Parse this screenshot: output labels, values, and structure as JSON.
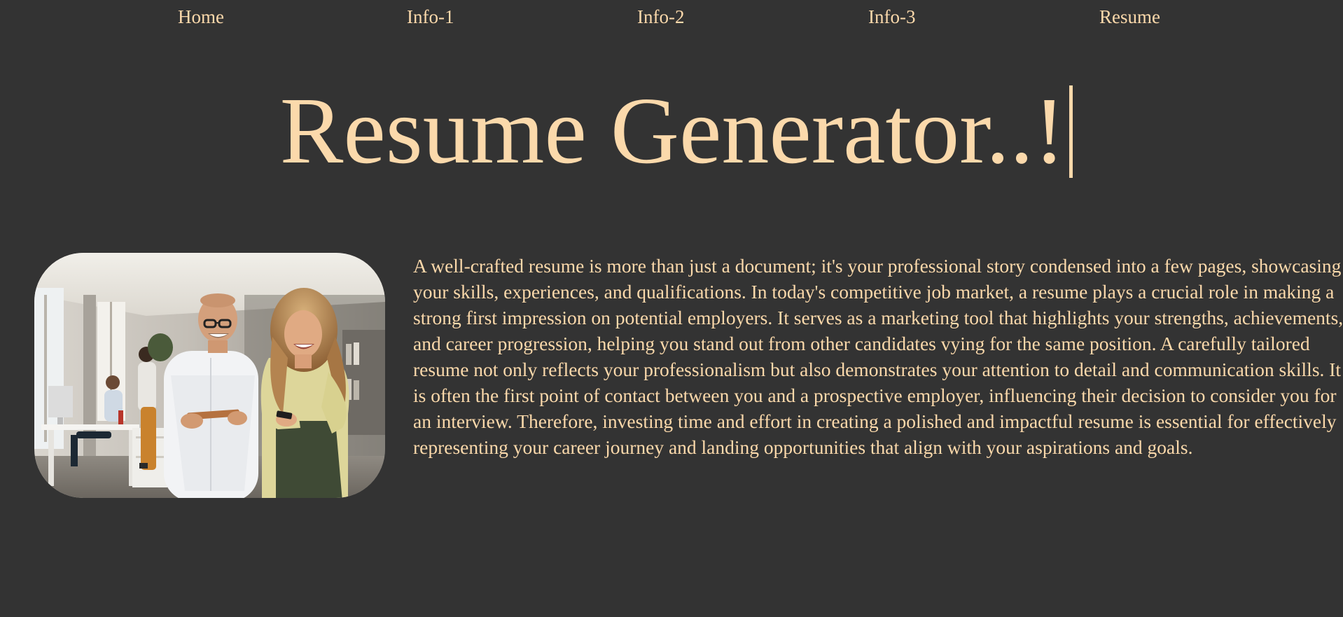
{
  "nav": {
    "items": [
      {
        "label": "Home"
      },
      {
        "label": "Info-1"
      },
      {
        "label": "Info-2"
      },
      {
        "label": "Info-3"
      },
      {
        "label": "Resume"
      }
    ]
  },
  "hero": {
    "title": "Resume Generator..!"
  },
  "photo": {
    "description": "Two colleagues smiling at a tablet in an office"
  },
  "intro": {
    "text": "A well-crafted resume is more than just a document; it's your professional story condensed into a few pages, showcasing your skills, experiences, and qualifications. In today's competitive job market, a resume plays a crucial role in making a strong first impression on potential employers. It serves as a marketing tool that highlights your strengths, achievements, and career progression, helping you stand out from other candidates vying for the same position. A carefully tailored resume not only reflects your professionalism but also demonstrates your attention to detail and communication skills. It is often the first point of contact between you and a prospective employer, influencing their decision to consider you for an interview. Therefore, investing time and effort in creating a polished and impactful resume is essential for effectively representing your career journey and landing opportunities that align with your aspirations and goals."
  },
  "colors": {
    "background": "#333333",
    "accent": "#fbd9ab"
  }
}
